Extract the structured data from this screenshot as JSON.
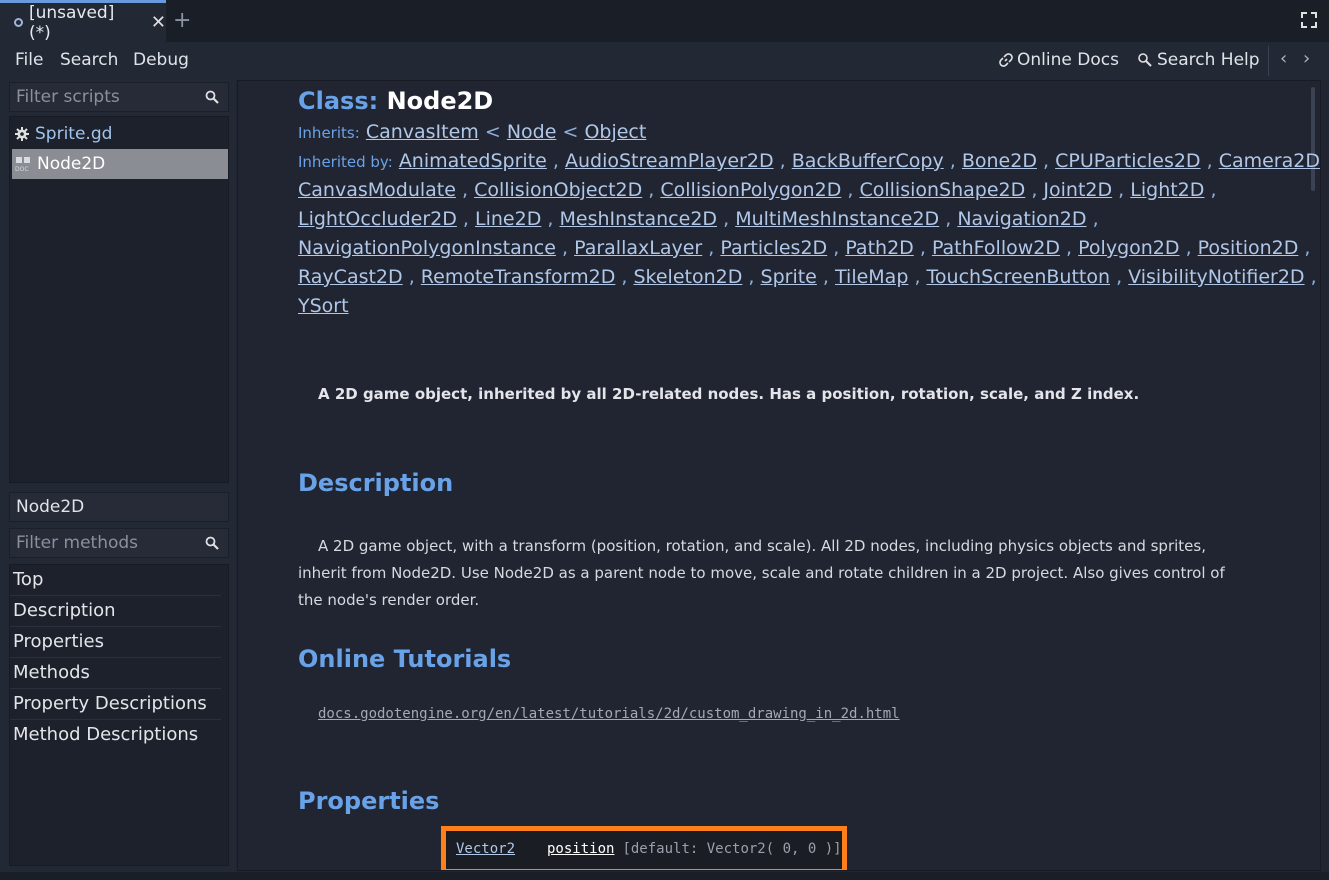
{
  "tab": {
    "title": "[unsaved](*)",
    "close": "✕",
    "add": "+"
  },
  "menu": {
    "file": "File",
    "search": "Search",
    "debug": "Debug",
    "online_docs": "Online Docs",
    "search_help": "Search Help",
    "back": "‹",
    "forward": "›"
  },
  "sidebar": {
    "filter_scripts_placeholder": "Filter scripts",
    "scripts": [
      {
        "label": "Sprite.gd",
        "icon": "gear-icon",
        "selected": false
      },
      {
        "label": "Node2D",
        "icon": "doc-icon",
        "selected": true
      }
    ],
    "current_class": "Node2D",
    "filter_methods_placeholder": "Filter methods",
    "sections": [
      "Top",
      "Description",
      "Properties",
      "Methods",
      "Property Descriptions",
      "Method Descriptions"
    ]
  },
  "doc": {
    "class_label": "Class:",
    "class_name": "Node2D",
    "inherits_label": "Inherits:",
    "inherits": [
      "CanvasItem",
      "Node",
      "Object"
    ],
    "inherits_sep": "<",
    "inherited_by_label": "Inherited by:",
    "inherited_by": [
      [
        "AnimatedSprite",
        "AudioStreamPlayer2D",
        "BackBufferCopy",
        "Bone2D",
        "CPUParticles2D",
        "Camera2D"
      ],
      [
        "CanvasModulate",
        "CollisionObject2D",
        "CollisionPolygon2D",
        "CollisionShape2D",
        "Joint2D",
        "Light2D"
      ],
      [
        "LightOccluder2D",
        "Line2D",
        "MeshInstance2D",
        "MultiMeshInstance2D",
        "Navigation2D"
      ],
      [
        "NavigationPolygonInstance",
        "ParallaxLayer",
        "Particles2D",
        "Path2D",
        "PathFollow2D",
        "Polygon2D",
        "Position2D"
      ],
      [
        "RayCast2D",
        "RemoteTransform2D",
        "Skeleton2D",
        "Sprite",
        "TileMap",
        "TouchScreenButton",
        "VisibilityNotifier2D"
      ],
      [
        "YSort"
      ]
    ],
    "list_sep": ",",
    "brief": "A 2D game object, inherited by all 2D-related nodes. Has a position, rotation, scale, and Z index.",
    "description_heading": "Description",
    "description": "A 2D game object, with a transform (position, rotation, and scale). All 2D nodes, including physics objects and sprites, inherit from Node2D. Use Node2D as a parent node to move, scale and rotate children in a 2D project. Also gives control of the node's render order.",
    "tutorials_heading": "Online Tutorials",
    "tutorial_link": "docs.godotengine.org/en/latest/tutorials/2d/custom_drawing_in_2d.html",
    "properties_heading": "Properties",
    "property": {
      "type": "Vector2",
      "name": "position",
      "default": "[default: Vector2( 0, 0 )]"
    }
  },
  "colors": {
    "accent": "#6aa2e8",
    "highlight": "#ff7f1a",
    "background": "#202531"
  }
}
